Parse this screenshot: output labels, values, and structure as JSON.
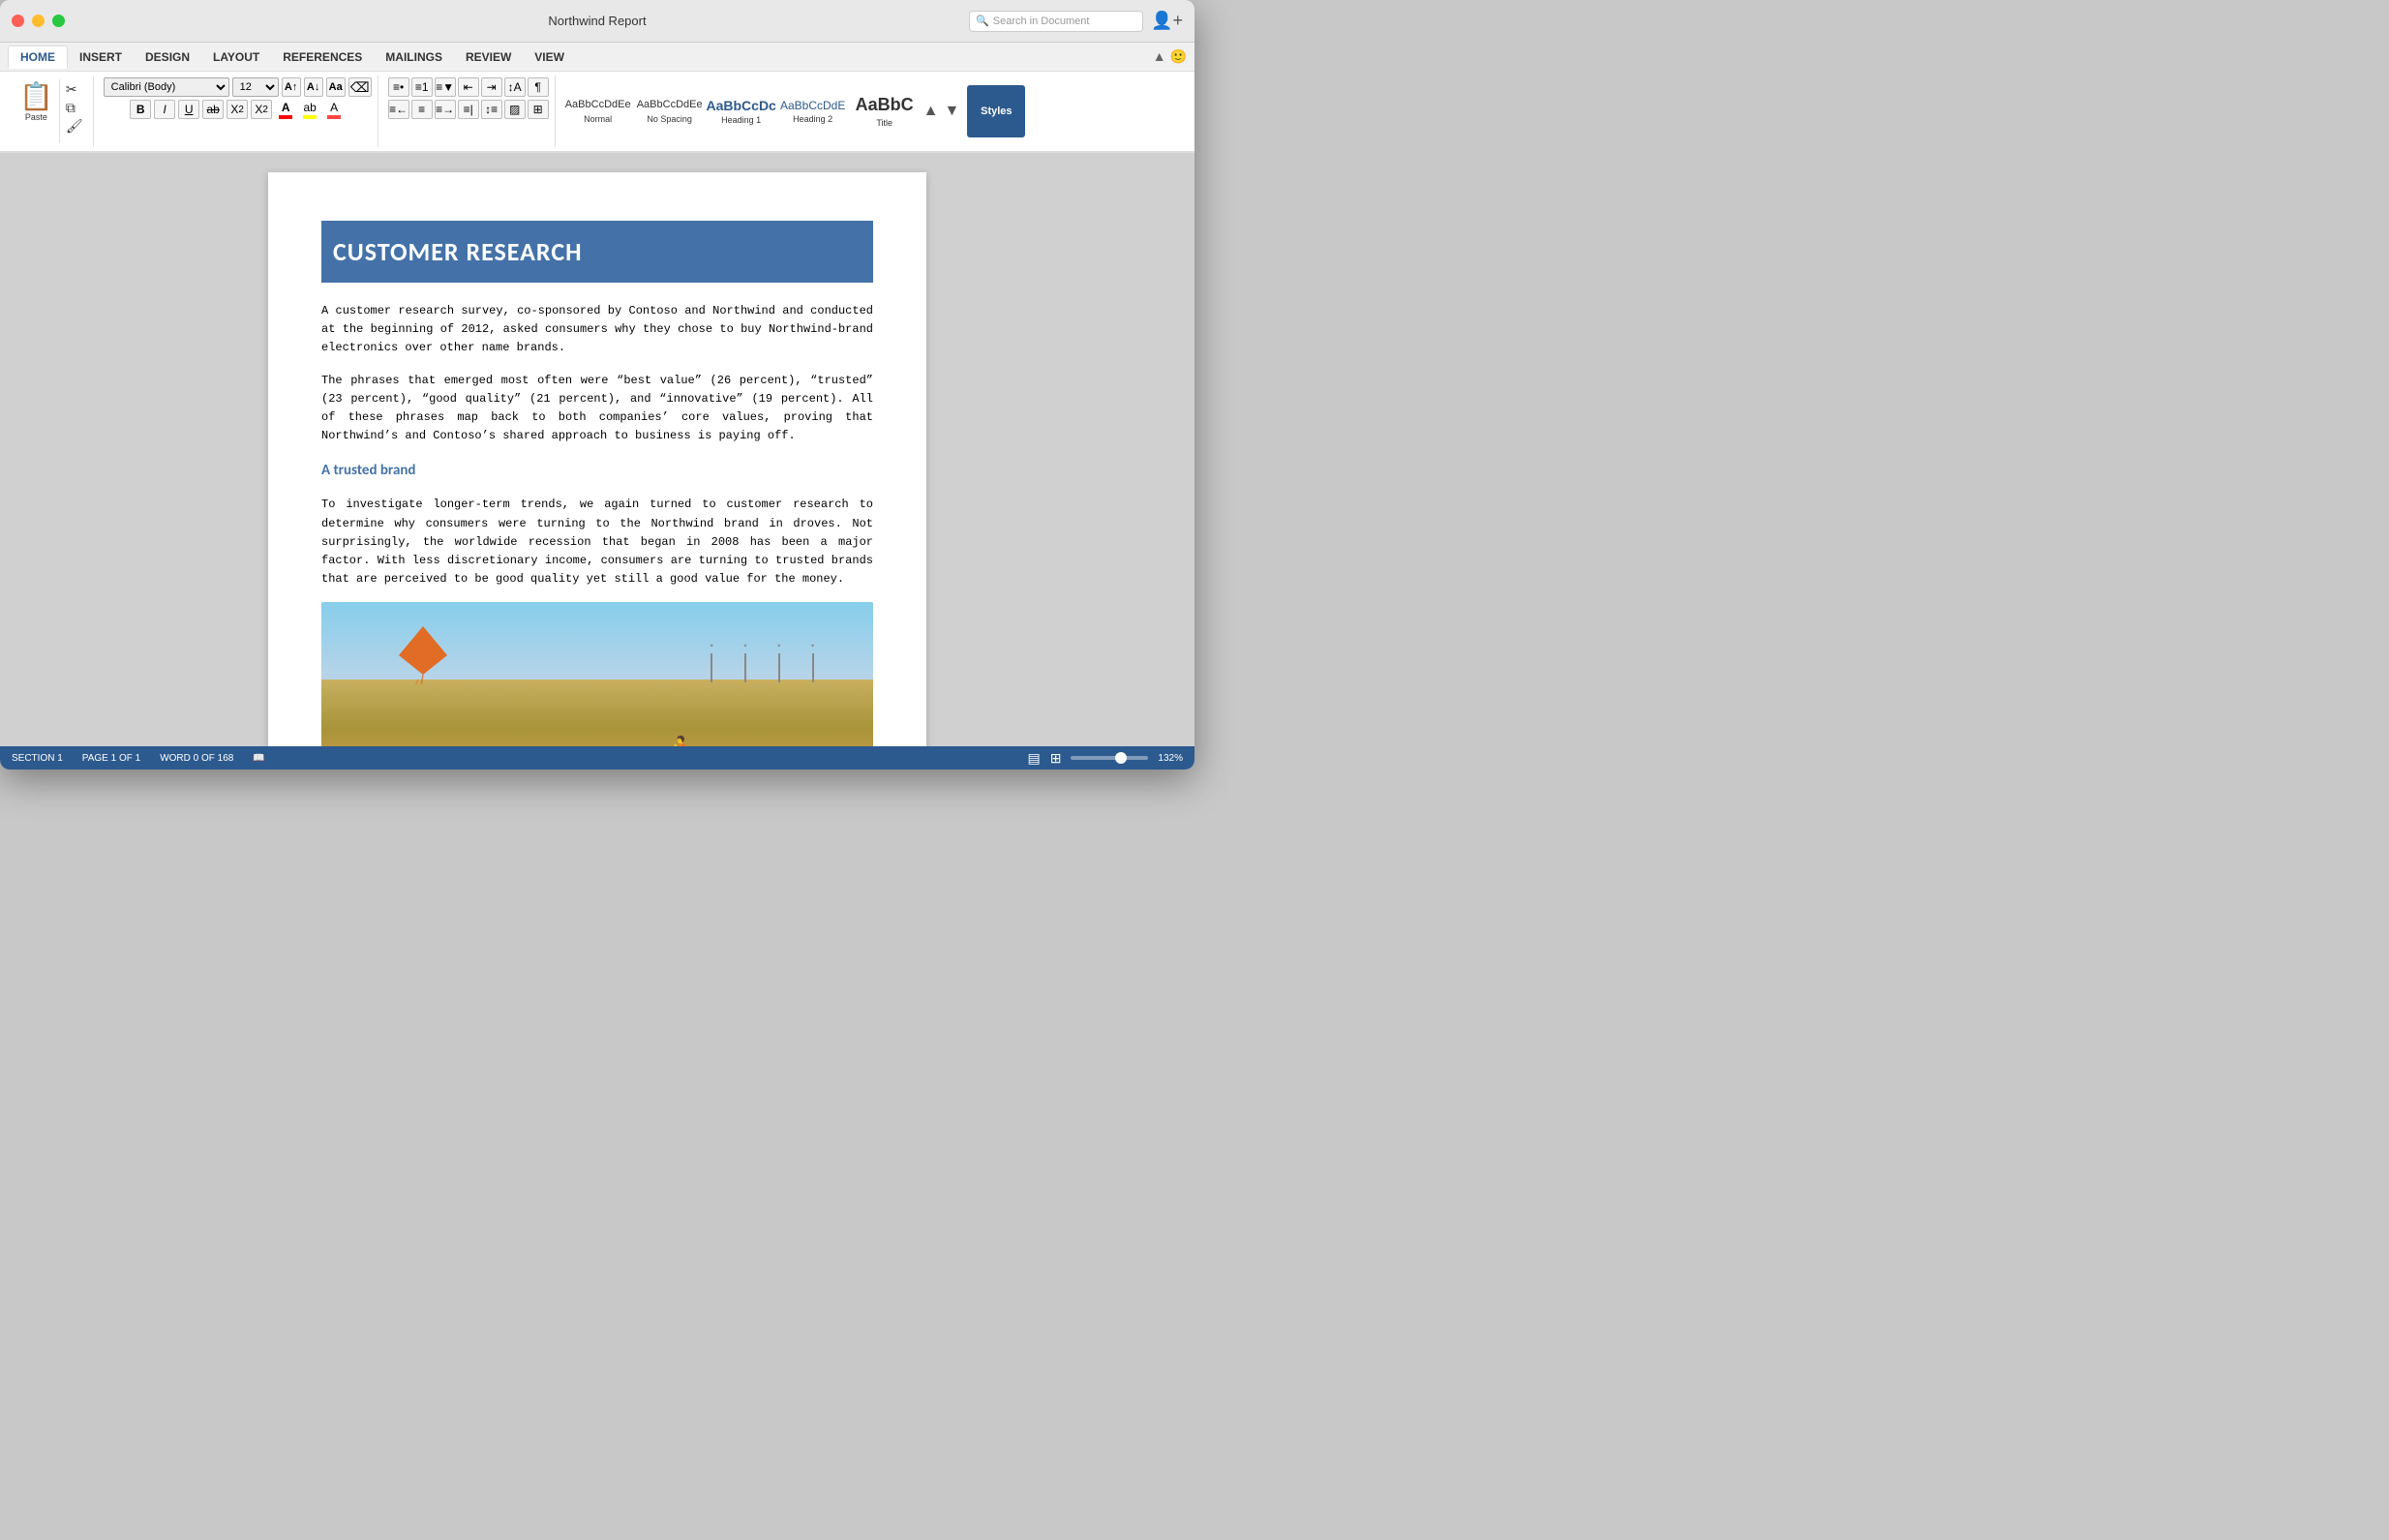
{
  "window": {
    "title": "Northwind Report"
  },
  "search": {
    "placeholder": "Search in Document"
  },
  "ribbon": {
    "tabs": [
      {
        "label": "HOME",
        "active": true
      },
      {
        "label": "INSERT",
        "active": false
      },
      {
        "label": "DESIGN",
        "active": false
      },
      {
        "label": "LAYOUT",
        "active": false
      },
      {
        "label": "REFERENCES",
        "active": false
      },
      {
        "label": "MAILINGS",
        "active": false
      },
      {
        "label": "REVIEW",
        "active": false
      },
      {
        "label": "VIEW",
        "active": false
      }
    ],
    "font": {
      "family": "Calibri (Body)",
      "size": "12"
    },
    "styles": [
      {
        "label": "Normal",
        "preview": "AaBbCcDdEe"
      },
      {
        "label": "No Spacing",
        "preview": "AaBbCcDdEe"
      },
      {
        "label": "Heading 1",
        "preview": "AaBbCcDc"
      },
      {
        "label": "Heading 2",
        "preview": "AaBbCcDdE"
      },
      {
        "label": "Title",
        "preview": "AaBbC"
      }
    ],
    "styles_label": "Styles",
    "paste_label": "Paste"
  },
  "document": {
    "heading": "CUSTOMER RESEARCH",
    "paragraph1": "A customer research survey, co-sponsored by Contoso and Northwind and conducted at the beginning of 2012, asked consumers why they chose to buy Northwind-brand electronics over other name brands.",
    "paragraph2": "The phrases that emerged most often were “best value” (26 percent), “trusted” (23 percent), “good quality” (21 percent), and “innovative” (19 percent). All of these phrases map back to both companies’ core values, proving that Northwind’s and Contoso’s shared approach to business is paying off.",
    "subheading": "A trusted brand",
    "paragraph3": "To investigate longer-term trends, we again turned to customer research to determine why consumers were turning to the Northwind brand in droves. Not surprisingly, the worldwide recession that began in 2008 has been a major factor. With less discretionary income, consumers are turning to trusted brands that are perceived to be good quality yet still a good value for the money."
  },
  "statusbar": {
    "section": "SECTION 1",
    "page": "PAGE 1 OF 1",
    "words": "WORD 0 OF 168",
    "zoom": "132%"
  }
}
